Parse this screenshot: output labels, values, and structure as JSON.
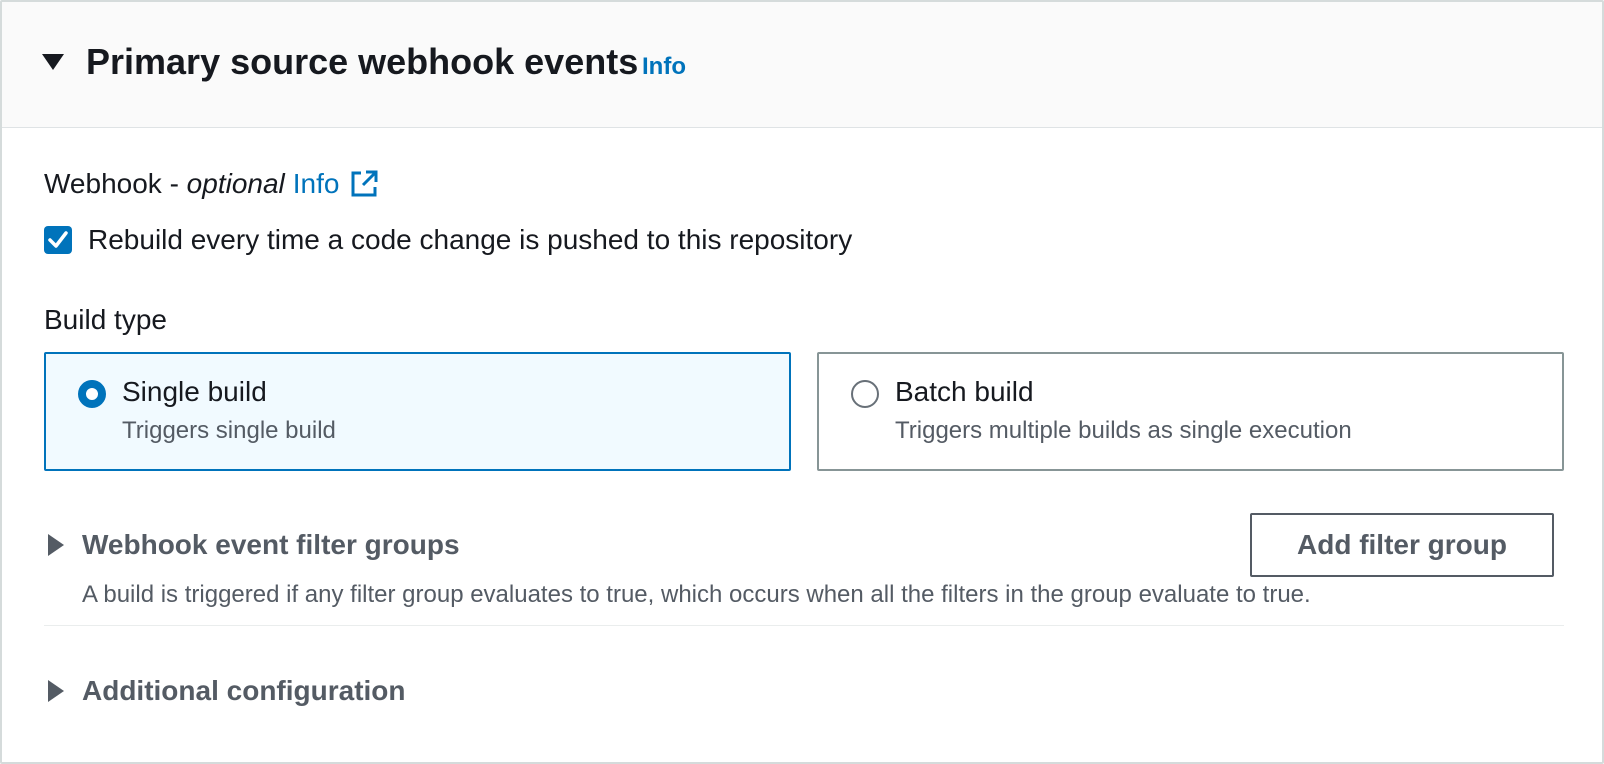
{
  "header": {
    "title": "Primary source webhook events",
    "info_label": "Info"
  },
  "webhook": {
    "label": "Webhook - ",
    "optional": "optional",
    "info_label": "Info",
    "checkbox_label": "Rebuild every time a code change is pushed to this repository",
    "checkbox_checked": true
  },
  "build_type": {
    "label": "Build type",
    "options": [
      {
        "title": "Single build",
        "description": "Triggers single build",
        "selected": true
      },
      {
        "title": "Batch build",
        "description": "Triggers multiple builds as single execution",
        "selected": false
      }
    ]
  },
  "filter_groups": {
    "title": "Webhook event filter groups",
    "description": "A build is triggered if any filter group evaluates to true, which occurs when all the filters in the group evaluate to true.",
    "add_button_label": "Add filter group"
  },
  "additional_config": {
    "title": "Additional configuration"
  },
  "colors": {
    "accent": "#0073bb",
    "header_bg": "#fafafa",
    "selected_tile_bg": "#f1faff",
    "secondary_text": "#545b64"
  },
  "icons": {
    "header_toggle": "caret-down-icon",
    "external_link": "external-link-icon",
    "checkbox_mark": "checkmark-icon",
    "expander": "caret-right-icon"
  }
}
